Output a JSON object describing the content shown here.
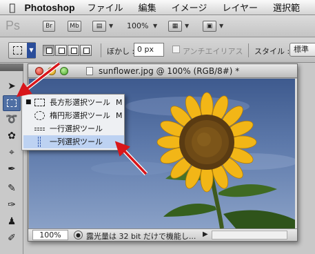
{
  "menubar": {
    "apple": "",
    "app": "Photoshop",
    "items": [
      "ファイル",
      "編集",
      "イメージ",
      "レイヤー",
      "選択範"
    ]
  },
  "appbar": {
    "logo": "Ps",
    "bridge": "Br",
    "minibridge": "Mb",
    "zoom": "100%"
  },
  "options": {
    "feather_label": "ぼかし :",
    "feather_value": "0 px",
    "antialias_label": "アンチエイリアス",
    "style_label": "スタイル :",
    "style_value": "標準"
  },
  "document": {
    "title": "sunflower.jpg @ 100% (RGB/8#) *",
    "status_zoom": "100%",
    "status_text": "露光量は 32 bit だけで機能し..."
  },
  "flyout": {
    "items": [
      {
        "label": "長方形選択ツール",
        "key": "M",
        "bullet": "■"
      },
      {
        "label": "楕円形選択ツール",
        "key": "M",
        "bullet": ""
      },
      {
        "label": "一行選択ツール",
        "key": "",
        "bullet": ""
      },
      {
        "label": "一列選択ツール",
        "key": "",
        "bullet": ""
      }
    ]
  },
  "colors": {
    "accent": "#4f6fa4",
    "highlight": "#bdd2f2",
    "arrow": "#d8161b",
    "petal": "#f2b617",
    "sky": "#4a669a"
  },
  "icons": {
    "apple": "apple-icon",
    "move": "move-tool-icon",
    "marquee": "rect-marquee-icon",
    "lasso": "lasso-icon",
    "quick_select": "quick-select-icon",
    "crop": "crop-icon",
    "eyedropper": "eyedropper-icon",
    "healing": "healing-brush-icon",
    "brush": "brush-icon",
    "stamp": "clone-stamp-icon",
    "history_brush": "history-brush-icon"
  }
}
